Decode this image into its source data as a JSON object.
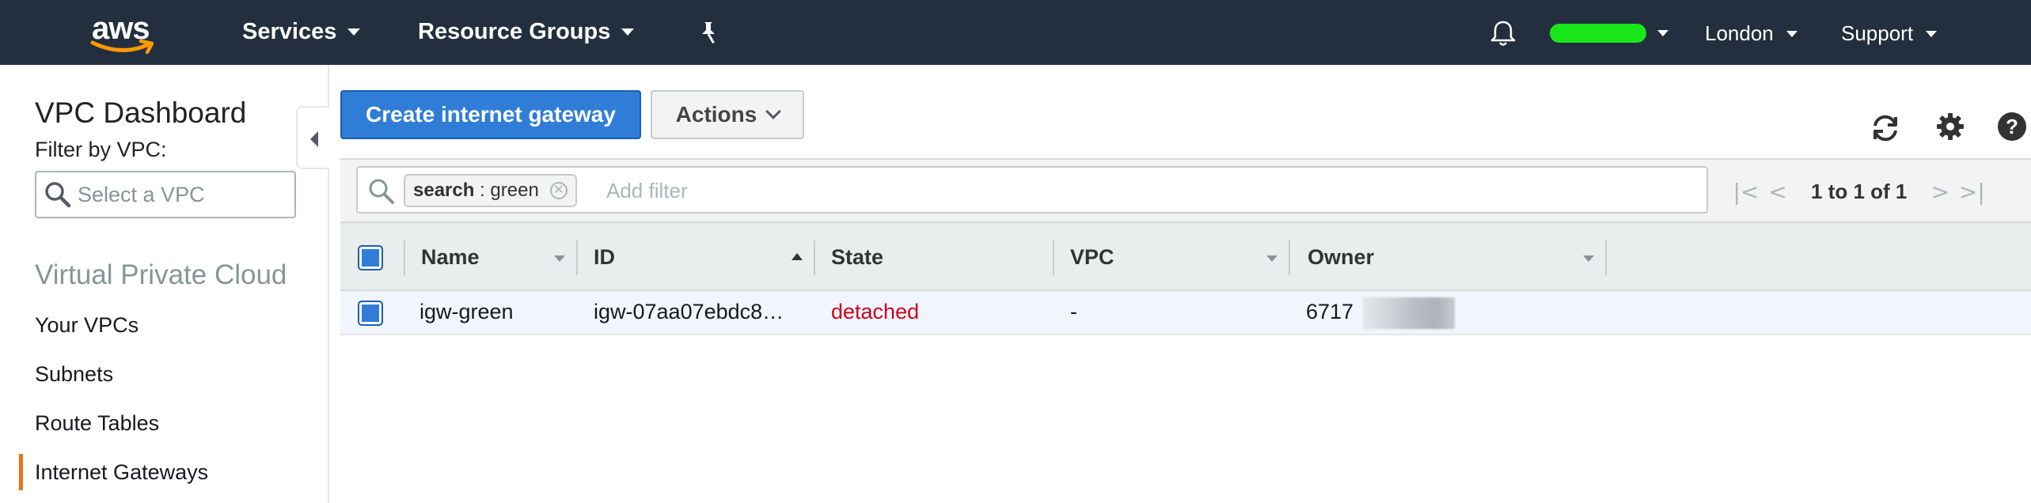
{
  "topnav": {
    "logo": "aws",
    "services": "Services",
    "resource_groups": "Resource Groups",
    "region": "London",
    "support": "Support",
    "colors": {
      "bg": "#232f3e",
      "account_bar": "#19e619"
    }
  },
  "sidebar": {
    "title": "VPC Dashboard",
    "filter_label": "Filter by VPC:",
    "select_placeholder": "Select a VPC",
    "section": "Virtual Private Cloud",
    "items": [
      {
        "label": "Your VPCs"
      },
      {
        "label": "Subnets"
      },
      {
        "label": "Route Tables"
      },
      {
        "label": "Internet Gateways",
        "active": true
      }
    ]
  },
  "toolbar": {
    "create_label": "Create internet gateway",
    "actions_label": "Actions"
  },
  "filter": {
    "token_key": "search",
    "token_sep": " : ",
    "token_value": "green",
    "add_placeholder": "Add filter",
    "pagination": "1 to 1 of 1"
  },
  "table": {
    "columns": [
      "Name",
      "ID",
      "State",
      "VPC",
      "Owner"
    ],
    "rows": [
      {
        "name": "igw-green",
        "id": "igw-07aa07ebdc8…",
        "state": "detached",
        "vpc": "-",
        "owner": "6717"
      }
    ]
  }
}
